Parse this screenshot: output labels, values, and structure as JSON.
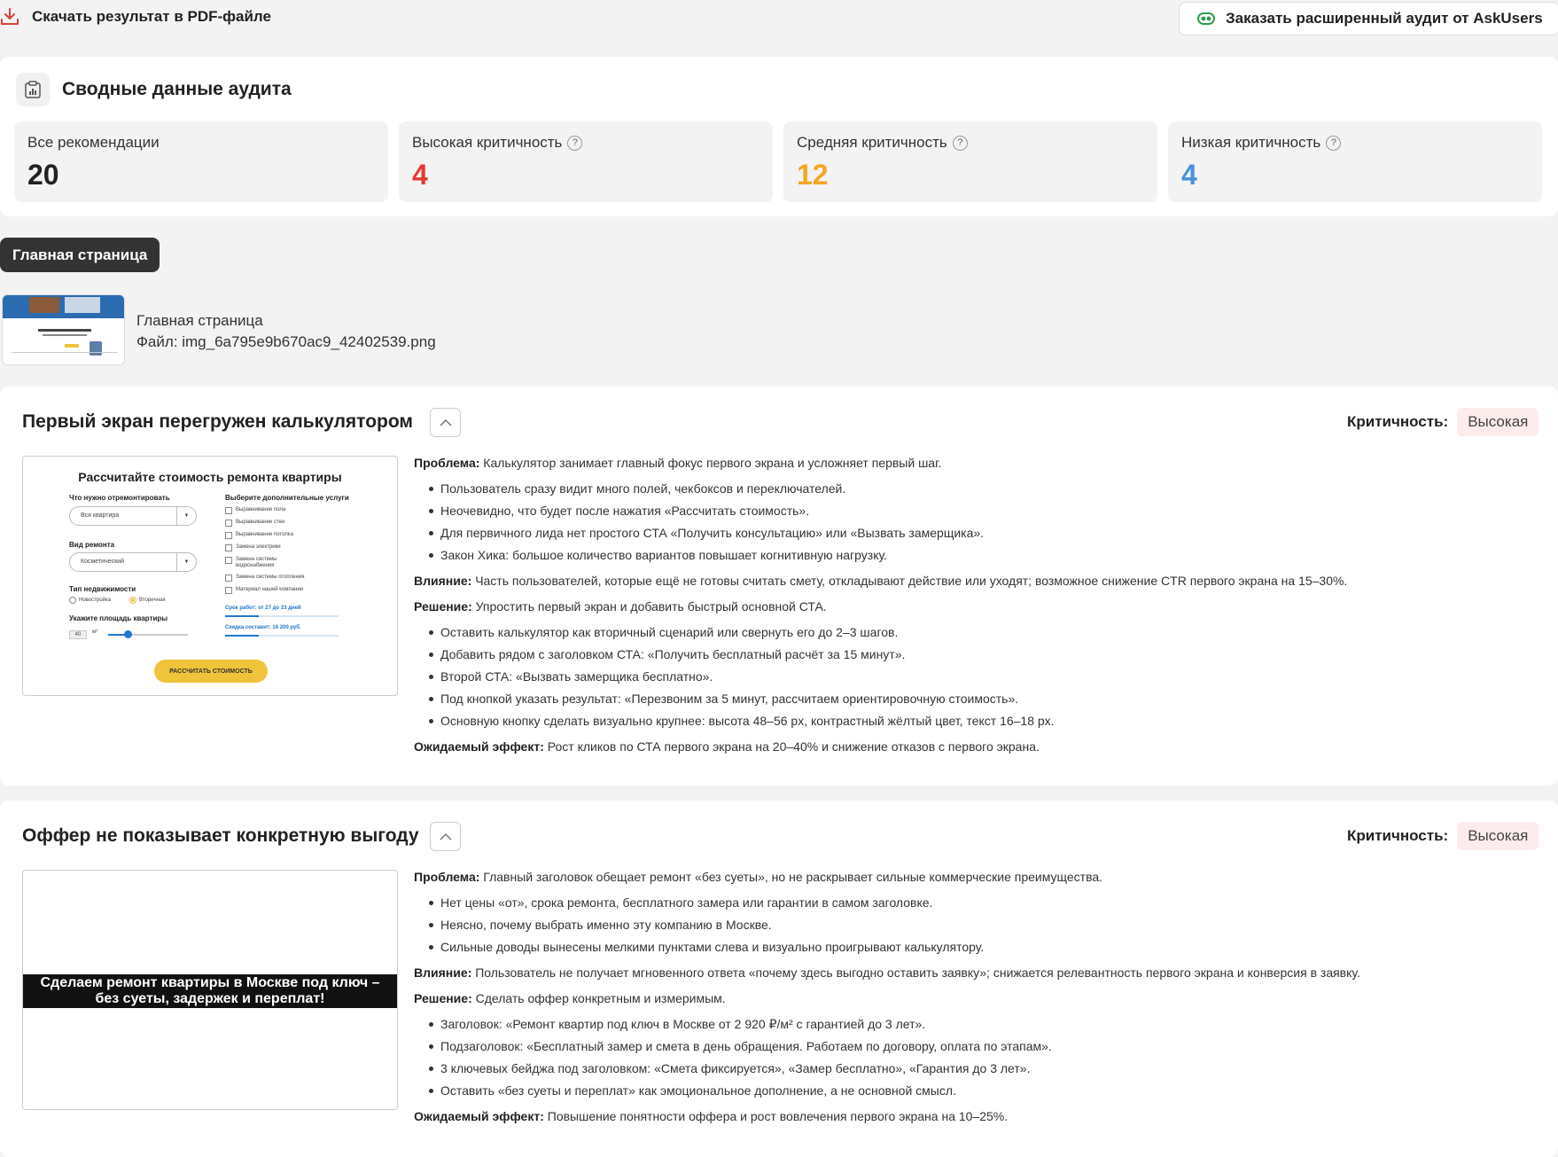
{
  "toolbar": {
    "pdf_label": "Скачать результат в PDF-файле",
    "order_label": "Заказать расширенный аудит от AskUsers"
  },
  "summary": {
    "title": "Сводные данные аудита",
    "stats": [
      {
        "label": "Все рекомендации",
        "value": "20",
        "color": "#222222"
      },
      {
        "label": "Высокая критичность",
        "value": "4",
        "color": "#e53935"
      },
      {
        "label": "Средняя критичность",
        "value": "12",
        "color": "#f5a623"
      },
      {
        "label": "Низкая критичность",
        "value": "4",
        "color": "#4a90e2"
      }
    ],
    "help_glyph": "?"
  },
  "page_tab": "Главная страница",
  "file": {
    "name": "Главная страница",
    "file_line": "Файл: img_6a795e9b670ac9_42402539.png"
  },
  "cards": [
    {
      "title": "Первый экран перегружен калькулятором",
      "crit_label": "Критичность:",
      "crit_value": "Высокая",
      "problem_label": "Проблема:",
      "problem": "Калькулятор занимает главный фокус первого экрана и усложняет первый шаг.",
      "problem_items": [
        "Пользователь сразу видит много полей, чекбоксов и переключателей.",
        "Неочевидно, что будет после нажатия «Рассчитать стоимость».",
        "Для первичного лида нет простого СТА «Получить консультацию» или «Вызвать замерщика».",
        "Закон Хика: большое количество вариантов повышает когнитивную нагрузку."
      ],
      "impact_label": "Влияние:",
      "impact": "Часть пользователей, которые ещё не готовы считать смету, откладывают действие или уходят; возможное снижение CTR первого экрана на 15–30%.",
      "solution_label": "Решение:",
      "solution": "Упростить первый экран и добавить быстрый основной СТА.",
      "solution_items": [
        "Оставить калькулятор как вторичный сценарий или свернуть его до 2–3 шагов.",
        "Добавить рядом с заголовком СТА: «Получить бесплатный расчёт за 15 минут».",
        "Второй СТА: «Вызвать замерщика бесплатно».",
        "Под кнопкой указать результат: «Перезвоним за 5 минут, рассчитаем ориентировочную стоимость».",
        "Основную кнопку сделать визуально крупнее: высота 48–56 px, контрастный жёлтый цвет, текст 16–18 px."
      ],
      "effect_label": "Ожидаемый эффект:",
      "effect": "Рост кликов по СТА первого экрана на 20–40% и снижение отказов с первого экрана."
    },
    {
      "title": "Оффер не показывает конкретную выгоду",
      "crit_label": "Критичность:",
      "crit_value": "Высокая",
      "problem_label": "Проблема:",
      "problem": "Главный заголовок обещает ремонт «без суеты», но не раскрывает сильные коммерческие преимущества.",
      "problem_items": [
        "Нет цены «от», срока ремонта, бесплатного замера или гарантии в самом заголовке.",
        "Неясно, почему выбрать именно эту компанию в Москве.",
        "Сильные доводы вынесены мелкими пунктами слева и визуально проигрывают калькулятору."
      ],
      "impact_label": "Влияние:",
      "impact": "Пользователь не получает мгновенного ответа «почему здесь выгодно оставить заявку»; снижается релевантность первого экрана и конверсия в заявку.",
      "solution_label": "Решение:",
      "solution": "Сделать оффер конкретным и измеримым.",
      "solution_items": [
        "Заголовок: «Ремонт квартир под ключ в Москве от 2 920 ₽/м² с гарантией до 3 лет».",
        "Подзаголовок: «Бесплатный замер и смета в день обращения. Работаем по договору, оплата по этапам».",
        "3 ключевых бейджа под заголовком: «Смета фиксируется», «Замер бесплатно», «Гарантия до 3 лет».",
        "Оставить «без суеты и переплат» как эмоциональное дополнение, а не основной смысл."
      ],
      "effect_label": "Ожидаемый эффект:",
      "effect": "Повышение понятности оффера и рост вовлечения первого экрана на 10–25%."
    }
  ],
  "calc_shot": {
    "title": "Рассчитайте стоимость ремонта квартиры",
    "what_label": "Что нужно отремонтировать",
    "what_value": "Вся квартира",
    "type_label": "Вид ремонта",
    "type_value": "Косметический",
    "estate_label": "Тип недвижимости",
    "estate_opt1": "Новостройка",
    "estate_opt2": "Вторичная",
    "area_label": "Укажите площадь квартиры",
    "area_value": "40",
    "area_unit": "м²",
    "extra_label": "Выберите дополнительные услуги",
    "extras": [
      "Выравнивание пола",
      "Выравнивание стен",
      "Выравнивание потолка",
      "Замена электрики",
      "Замена системы водоснабжения",
      "Замена системы отопления",
      "Материал нашей компании"
    ],
    "term": "Срок работ: от 27 до 33 дней",
    "discount": "Скидка составит: 16 200 руб.",
    "button": "РАССЧИТАТЬ СТОИМОСТЬ",
    "arrow": "▼"
  },
  "offer_shot": {
    "line1": "Сделаем ремонт квартиры в Москве под ключ –",
    "line2": "без суеты, задержек и переплат!"
  }
}
